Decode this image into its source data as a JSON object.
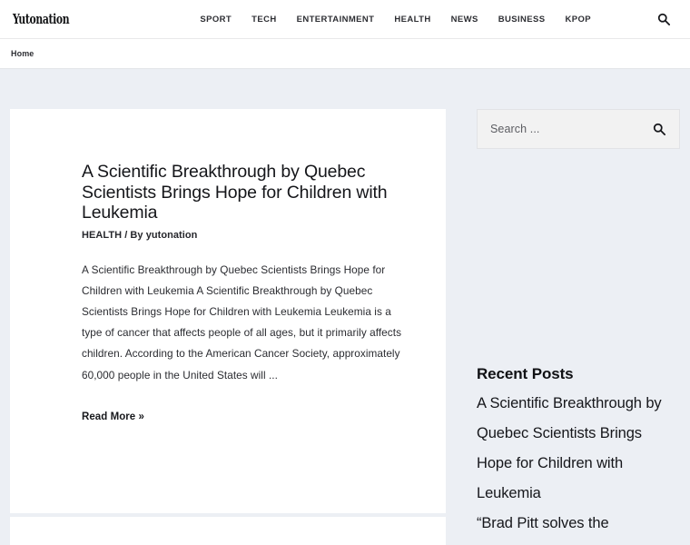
{
  "header": {
    "brand": "Yutonation",
    "nav": [
      {
        "label": "SPORT"
      },
      {
        "label": "TECH"
      },
      {
        "label": "ENTERTAINMENT"
      },
      {
        "label": "HEALTH"
      },
      {
        "label": "NEWS"
      },
      {
        "label": "BUSINESS"
      },
      {
        "label": "KPOP"
      }
    ],
    "search_icon": "search-icon"
  },
  "breadcrumb": {
    "items": [
      {
        "label": "Home"
      }
    ]
  },
  "article": {
    "title": "A Scientific Breakthrough by Quebec Scientists Brings Hope for Children with Leukemia",
    "category": "HEALTH",
    "meta_separator": "/",
    "by_prefix": "By",
    "author": "yutonation",
    "excerpt": "A Scientific Breakthrough by Quebec Scientists Brings Hope for Children with Leukemia A Scientific Breakthrough by Quebec Scientists Brings Hope for Children with Leukemia Leukemia is a type of cancer that affects people of all ages, but it primarily affects children. According to the American Cancer Society, approximately 60,000 people in the United States will ...",
    "read_more": "Read More »"
  },
  "sidebar": {
    "search": {
      "placeholder": "Search ...",
      "value": "",
      "submit_icon": "search-icon"
    },
    "recent_posts": {
      "title": "Recent Posts",
      "items": [
        {
          "label": "A Scientific Breakthrough by Quebec Scientists Brings Hope for Children with Leukemia"
        },
        {
          "label": "“Brad Pitt solves the"
        }
      ]
    }
  },
  "colors": {
    "page_background": "#eceff4",
    "card_background": "#ffffff",
    "text_primary": "#15161a",
    "search_field": "#f2f2f2"
  }
}
